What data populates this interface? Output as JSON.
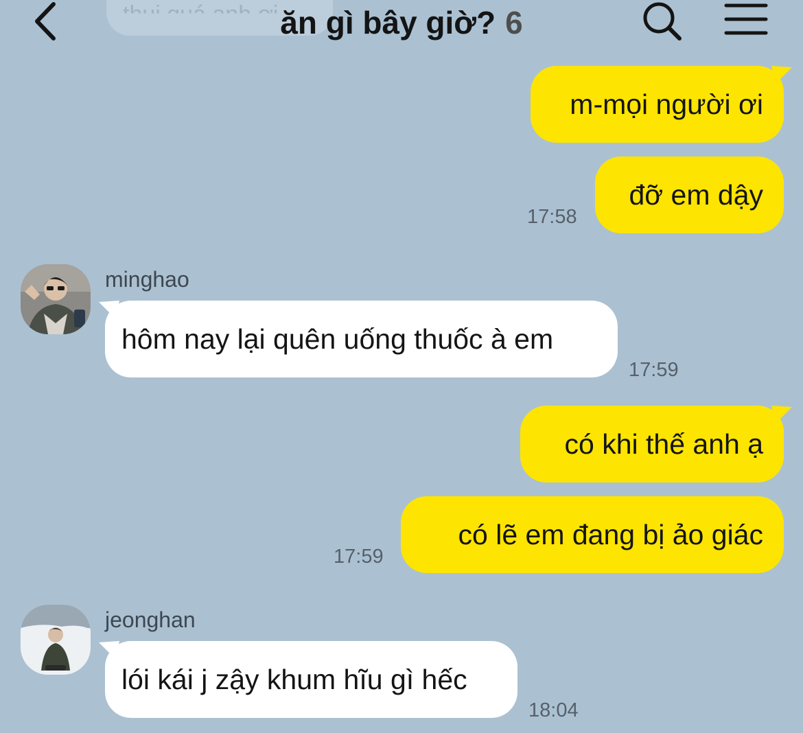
{
  "header": {
    "title": "ăn gì bây giờ?",
    "member_count": "6",
    "hidden_message": "thui quá anh ơi",
    "icons": {
      "back": "back-chevron-icon",
      "search": "search-icon",
      "menu": "menu-icon"
    }
  },
  "colors": {
    "background": "#abc1d2",
    "my_bubble": "#fde401",
    "other_bubble": "#ffffff"
  },
  "messages": [
    {
      "sender": "me",
      "text": "m-mọi người ơi"
    },
    {
      "sender": "me",
      "text": "đỡ em dậy",
      "time": "17:58"
    },
    {
      "sender": "minghao",
      "text": "hôm nay lại quên uống thuốc à em",
      "time": "17:59"
    },
    {
      "sender": "me",
      "text": "có khi thế anh ạ"
    },
    {
      "sender": "me",
      "text": "có lẽ em đang bị ảo giác",
      "time": "17:59"
    },
    {
      "sender": "jeonghan",
      "text": "lói kái j zậy khum hĩu gì hếc",
      "time": "18:04"
    }
  ]
}
